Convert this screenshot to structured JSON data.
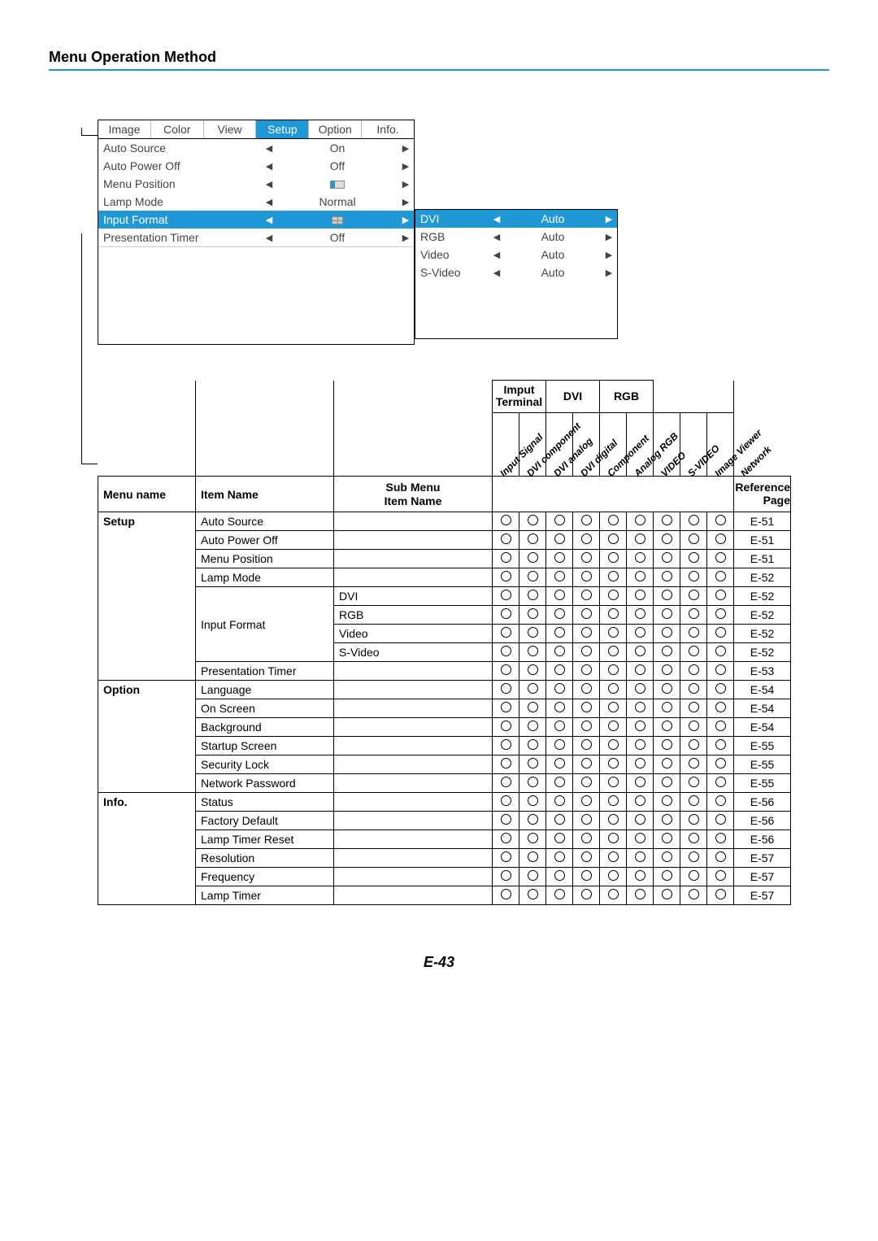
{
  "page": {
    "section_title": "Menu Operation Method",
    "page_number": "E-43"
  },
  "osd": {
    "tabs": [
      "Image",
      "Color",
      "View",
      "Setup",
      "Option",
      "Info."
    ],
    "active_tab_index": 3,
    "rows": [
      {
        "label": "Auto Source",
        "value": "On",
        "type": "text"
      },
      {
        "label": "Auto Power Off",
        "value": "Off",
        "type": "text"
      },
      {
        "label": "Menu Position",
        "value": "",
        "type": "slider"
      },
      {
        "label": "Lamp Mode",
        "value": "Normal",
        "type": "text"
      },
      {
        "label": "Input Format",
        "value": "",
        "type": "grid",
        "highlight": true
      },
      {
        "label": "Presentation Timer",
        "value": "Off",
        "type": "text"
      }
    ],
    "submenu": [
      {
        "label": "DVI",
        "value": "Auto",
        "highlight": true
      },
      {
        "label": "RGB",
        "value": "Auto"
      },
      {
        "label": "Video",
        "value": "Auto"
      },
      {
        "label": "S-Video",
        "value": "Auto"
      }
    ]
  },
  "ref": {
    "headers": {
      "menu_name": "Menu name",
      "item_name": "Item Name",
      "sub_menu_1": "Sub Menu",
      "sub_menu_2": "Item Name",
      "group_input_terminal": "Imput Terminal",
      "group_dvi": "DVI",
      "group_rgb": "RGB",
      "diagonal": [
        "Input Signal",
        "DVI component",
        "DVI analog",
        "DVI digital",
        "Component",
        "Analog RGB",
        "VIDEO",
        "S-VIDEO",
        "Image Viewer",
        "Network"
      ],
      "ref_page_1": "Reference",
      "ref_page_2": "Page"
    },
    "rows": [
      {
        "menu": "Setup",
        "item": "Auto Source",
        "sub": "",
        "marks": [
          1,
          1,
          1,
          1,
          1,
          1,
          1,
          1,
          1
        ],
        "ref": "E-51",
        "first": true
      },
      {
        "menu": "",
        "item": "Auto Power Off",
        "sub": "",
        "marks": [
          1,
          1,
          1,
          1,
          1,
          1,
          1,
          1,
          1
        ],
        "ref": "E-51"
      },
      {
        "menu": "",
        "item": "Menu Position",
        "sub": "",
        "marks": [
          1,
          1,
          1,
          1,
          1,
          1,
          1,
          1,
          1
        ],
        "ref": "E-51"
      },
      {
        "menu": "",
        "item": "Lamp Mode",
        "sub": "",
        "marks": [
          1,
          1,
          1,
          1,
          1,
          1,
          1,
          1,
          1
        ],
        "ref": "E-52"
      },
      {
        "menu": "",
        "item": "Input Format",
        "sub": "DVI",
        "marks": [
          1,
          1,
          1,
          1,
          1,
          1,
          1,
          1,
          1
        ],
        "ref": "E-52"
      },
      {
        "menu": "",
        "item": "",
        "sub": "RGB",
        "marks": [
          1,
          1,
          1,
          1,
          1,
          1,
          1,
          1,
          1
        ],
        "ref": "E-52"
      },
      {
        "menu": "",
        "item": "",
        "sub": "Video",
        "marks": [
          1,
          1,
          1,
          1,
          1,
          1,
          1,
          1,
          1
        ],
        "ref": "E-52"
      },
      {
        "menu": "",
        "item": "",
        "sub": "S-Video",
        "marks": [
          1,
          1,
          1,
          1,
          1,
          1,
          1,
          1,
          1
        ],
        "ref": "E-52"
      },
      {
        "menu": "",
        "item": "Presentation Timer",
        "sub": "",
        "marks": [
          1,
          1,
          1,
          1,
          1,
          1,
          1,
          1,
          1
        ],
        "ref": "E-53"
      },
      {
        "menu": "Option",
        "item": "Language",
        "sub": "",
        "marks": [
          1,
          1,
          1,
          1,
          1,
          1,
          1,
          1,
          1
        ],
        "ref": "E-54",
        "first": true
      },
      {
        "menu": "",
        "item": "On Screen",
        "sub": "",
        "marks": [
          1,
          1,
          1,
          1,
          1,
          1,
          1,
          1,
          1
        ],
        "ref": "E-54"
      },
      {
        "menu": "",
        "item": "Background",
        "sub": "",
        "marks": [
          1,
          1,
          1,
          1,
          1,
          1,
          1,
          1,
          1
        ],
        "ref": "E-54"
      },
      {
        "menu": "",
        "item": "Startup Screen",
        "sub": "",
        "marks": [
          1,
          1,
          1,
          1,
          1,
          1,
          1,
          1,
          1
        ],
        "ref": "E-55"
      },
      {
        "menu": "",
        "item": "Security Lock",
        "sub": "",
        "marks": [
          1,
          1,
          1,
          1,
          1,
          1,
          1,
          1,
          1
        ],
        "ref": "E-55"
      },
      {
        "menu": "",
        "item": "Network Password",
        "sub": "",
        "marks": [
          1,
          1,
          1,
          1,
          1,
          1,
          1,
          1,
          1
        ],
        "ref": "E-55"
      },
      {
        "menu": "Info.",
        "item": "Status",
        "sub": "",
        "marks": [
          1,
          1,
          1,
          1,
          1,
          1,
          1,
          1,
          1
        ],
        "ref": "E-56",
        "first": true
      },
      {
        "menu": "",
        "item": "Factory Default",
        "sub": "",
        "marks": [
          1,
          1,
          1,
          1,
          1,
          1,
          1,
          1,
          1
        ],
        "ref": "E-56"
      },
      {
        "menu": "",
        "item": "Lamp Timer Reset",
        "sub": "",
        "marks": [
          1,
          1,
          1,
          1,
          1,
          1,
          1,
          1,
          1
        ],
        "ref": "E-56"
      },
      {
        "menu": "",
        "item": "Resolution",
        "sub": "",
        "marks": [
          1,
          1,
          1,
          1,
          1,
          1,
          1,
          1,
          1
        ],
        "ref": "E-57"
      },
      {
        "menu": "",
        "item": "Frequency",
        "sub": "",
        "marks": [
          1,
          1,
          1,
          1,
          1,
          1,
          1,
          1,
          1
        ],
        "ref": "E-57"
      },
      {
        "menu": "",
        "item": "Lamp Timer",
        "sub": "",
        "marks": [
          1,
          1,
          1,
          1,
          1,
          1,
          1,
          1,
          1
        ],
        "ref": "E-57"
      }
    ]
  }
}
